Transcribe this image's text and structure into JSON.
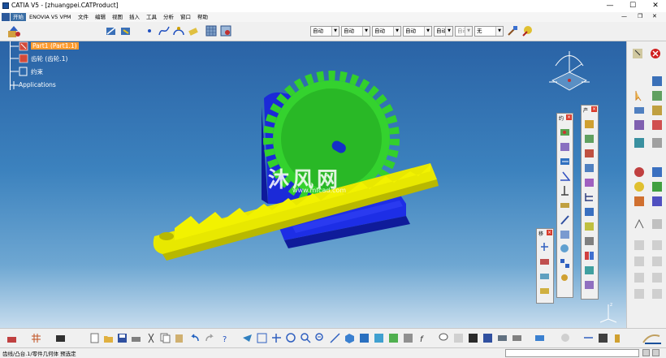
{
  "window": {
    "title": "CATIA V5 - [zhuangpei.CATProduct]",
    "minimize": "—",
    "maximize": "☐",
    "close": "✕"
  },
  "menu": {
    "items": [
      "开始",
      "ENOVIA V5 VPM",
      "文件",
      "编辑",
      "视图",
      "插入",
      "工具",
      "分析",
      "窗口",
      "帮助"
    ]
  },
  "toolbar": {
    "combos": [
      "自动",
      "自动",
      "自动",
      "自动",
      "自动",
      "自动",
      "无"
    ]
  },
  "tree": {
    "nodes": [
      "Part1 (Part1.1)",
      "齿轮 (齿轮.1)",
      "约束",
      "Applications"
    ]
  },
  "watermark": {
    "brand": "沐风网",
    "url": "www.mfcad.com"
  },
  "panels": {
    "constraint_title": "约",
    "product_title": "产",
    "move_title": "移"
  },
  "status": {
    "text": "齿线/凸台.1/零件几何体 预选定"
  },
  "colors": {
    "accent": "#3a6ea5",
    "gear": "#22c020",
    "rack": "#f2f200",
    "support": "#1d2ee6"
  }
}
